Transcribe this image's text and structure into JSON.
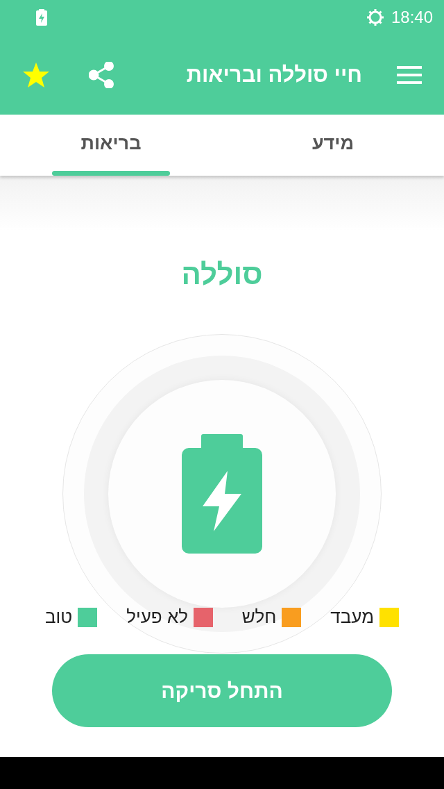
{
  "status_bar": {
    "time": "18:40"
  },
  "app_bar": {
    "title": "חיי סוללה ובריאות"
  },
  "tabs": [
    {
      "label": "מידע",
      "selected": false
    },
    {
      "label": "בריאות",
      "selected": true
    }
  ],
  "heading": "סוללה",
  "legend": [
    {
      "label": "מעבד",
      "color": "#ffe100"
    },
    {
      "label": "חלש",
      "color": "#f99d1f"
    },
    {
      "label": "לא פעיל",
      "color": "#e6636b"
    },
    {
      "label": "טוב",
      "color": "#4ecd9a"
    }
  ],
  "scan_button": "התחל סריקה"
}
